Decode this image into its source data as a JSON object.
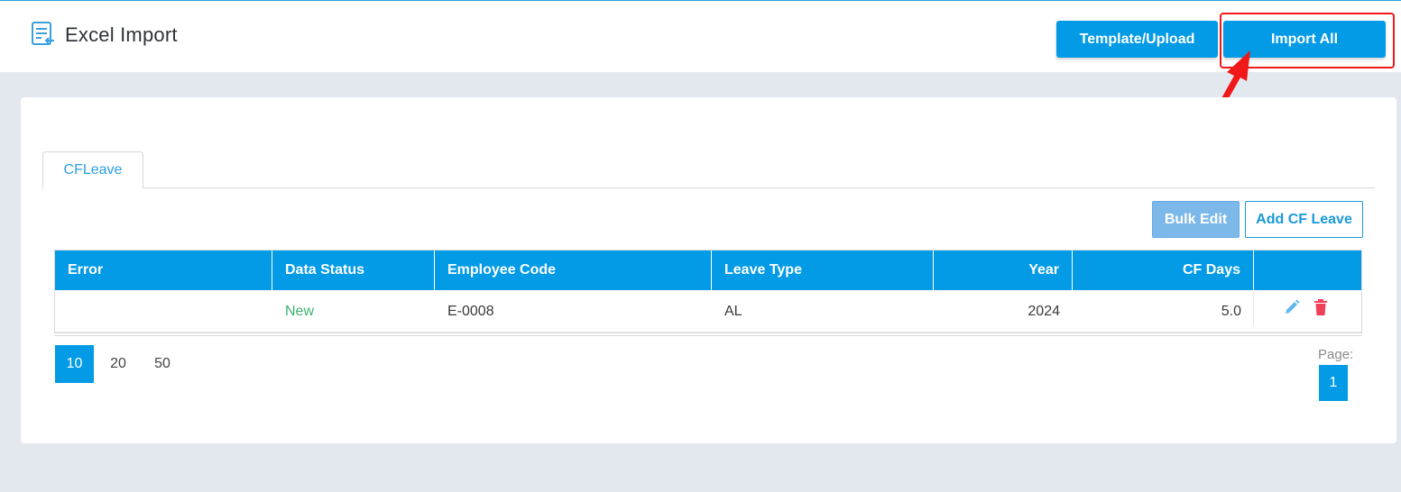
{
  "header": {
    "title": "Excel Import",
    "icon": "excel-import-icon",
    "template_upload_label": "Template/Upload",
    "import_all_label": "Import All"
  },
  "tabs": [
    {
      "label": "CFLeave",
      "active": true
    }
  ],
  "toolbar": {
    "bulk_edit_label": "Bulk Edit",
    "add_label": "Add CF Leave"
  },
  "table": {
    "columns": [
      "Error",
      "Data Status",
      "Employee Code",
      "Leave Type",
      "Year",
      "CF Days"
    ],
    "rows": [
      {
        "error": "",
        "data_status": "New",
        "employee_code": "E-0008",
        "leave_type": "AL",
        "year": "2024",
        "cf_days": "5.0",
        "actions": [
          "edit-icon",
          "delete-icon"
        ]
      }
    ]
  },
  "pagination": {
    "page_sizes": [
      "10",
      "20",
      "50"
    ],
    "selected_page_size": "10",
    "page_label": "Page:",
    "pages": [
      "1"
    ],
    "current_page": "1"
  },
  "colors": {
    "primary": "#039be5",
    "status_new": "#3cb371",
    "delete": "#f0405a",
    "highlight": "#f01818"
  }
}
